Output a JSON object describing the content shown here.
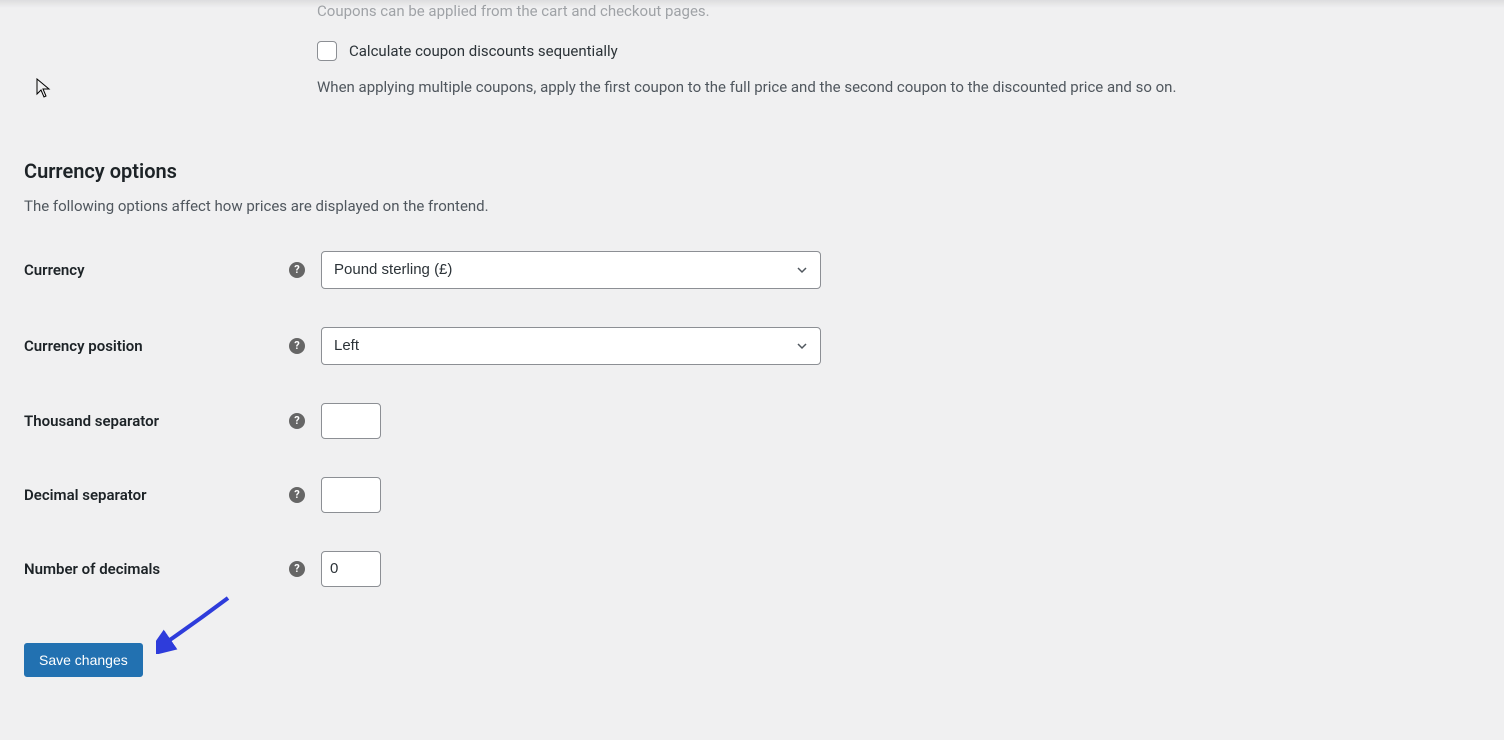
{
  "coupon": {
    "applied_text": "Coupons can be applied from the cart and checkout pages.",
    "sequential_label": "Calculate coupon discounts sequentially",
    "sequential_desc": "When applying multiple coupons, apply the first coupon to the full price and the second coupon to the discounted price and so on."
  },
  "currency_section": {
    "heading": "Currency options",
    "desc": "The following options affect how prices are displayed on the frontend."
  },
  "fields": {
    "currency": {
      "label": "Currency",
      "value": "Pound sterling (£)"
    },
    "position": {
      "label": "Currency position",
      "value": "Left"
    },
    "thousand": {
      "label": "Thousand separator",
      "value": ""
    },
    "decimal": {
      "label": "Decimal separator",
      "value": ""
    },
    "decimals": {
      "label": "Number of decimals",
      "value": "0"
    }
  },
  "buttons": {
    "save": "Save changes"
  },
  "help_char": "?"
}
